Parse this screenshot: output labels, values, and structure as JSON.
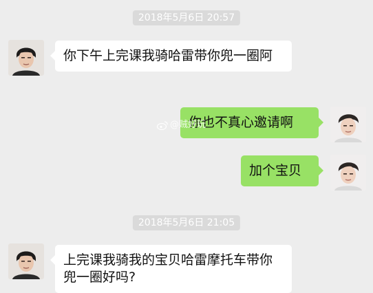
{
  "timestamps": [
    "2018年5月6日 20:57",
    "2018年5月6日 21:05"
  ],
  "watermark": "@贼好玩",
  "messages": [
    {
      "side": "left",
      "text": "你下午上完课我骑哈雷带你兜一圈阿"
    },
    {
      "side": "right",
      "text": "你也不真心邀请啊"
    },
    {
      "side": "right",
      "text": "加个宝贝"
    },
    {
      "side": "left",
      "text": "上完课我骑我的宝贝哈雷摩托车带你兜一圈好吗?"
    }
  ],
  "icons": {
    "avatar": "person-avatar-icon",
    "watermark": "weibo-icon"
  },
  "colors": {
    "background": "#ededed",
    "incoming_bubble": "#ffffff",
    "outgoing_bubble": "#98e165",
    "timestamp_bg": "#dadada"
  }
}
